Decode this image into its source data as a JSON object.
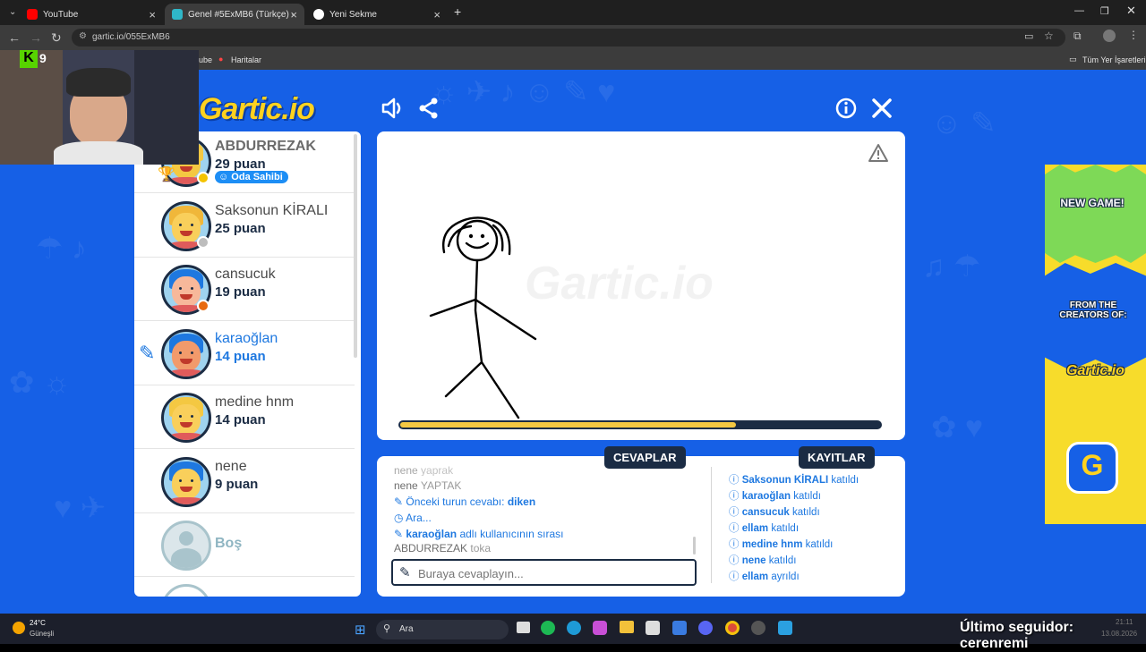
{
  "browser": {
    "tabs": [
      {
        "label": "YouTube",
        "active": false
      },
      {
        "label": "Genel #5ExMB6 (Türkçe) - Gartic",
        "active": true
      },
      {
        "label": "Yeni Sekme",
        "active": false
      }
    ],
    "new_tab": "+",
    "url": "gartic.io/055ExMB6",
    "bookmarks": [
      "ube",
      "Haritalar"
    ],
    "all_bookmarks": "Tüm Yer İşaretleri"
  },
  "webcam": {
    "badge_k": "K",
    "badge_num": "9"
  },
  "game": {
    "logo": "Gartic.io",
    "players": [
      {
        "name": "ABDURREZAK",
        "points": "29 puan",
        "badge": "Oda Sahibi",
        "bold_name": true,
        "dot": "#f4c300",
        "skin": "#f4c842",
        "hair": "#f4c842"
      },
      {
        "name": "Saksonun KİRALI",
        "points": "25 puan",
        "dot": "#bdbdbd",
        "skin": "#f9cf5b",
        "hair": "#f0b73a"
      },
      {
        "name": "cansucuk",
        "points": "19 puan",
        "dot": "#e8690e",
        "skin": "#f7b89a",
        "hair": "#1e78e0"
      },
      {
        "name": "karaoğlan",
        "points": "14 puan",
        "drawing": true,
        "skin": "#f29a6b",
        "hair": "#1e78e0"
      },
      {
        "name": "medine hnm",
        "points": "14 puan",
        "skin": "#f9cf5b",
        "hair": "#f4c842"
      },
      {
        "name": "nene",
        "points": "9 puan",
        "skin": "#f9cf5b",
        "hair": "#1e78e0"
      },
      {
        "name": "Boş",
        "points": ""
      }
    ],
    "progress_fraction": 0.7,
    "answers_title": "CEVAPLAR",
    "log_title": "KAYITLAR",
    "chat": [
      {
        "user": "nene",
        "text": "yaprak"
      },
      {
        "user": "nene",
        "text": "YAPTAK"
      },
      {
        "label": "Önceki turun cevabı:",
        "value": "diken",
        "icon": "pencil"
      },
      {
        "label": "Ara...",
        "icon": "clock"
      },
      {
        "user": "karaoğlan",
        "text": "adlı kullanıcının sırası",
        "icon": "pencil"
      },
      {
        "user": "ABDURREZAK",
        "text": "toka"
      }
    ],
    "answer_placeholder": "Buraya cevaplayın...",
    "log": [
      {
        "user": "Saksonun KİRALI",
        "action": "katıldı"
      },
      {
        "user": "karaoğlan",
        "action": "katıldı"
      },
      {
        "user": "cansucuk",
        "action": "katıldı"
      },
      {
        "user": "ellam",
        "action": "katıldı"
      },
      {
        "user": "medine hnm",
        "action": "katıldı"
      },
      {
        "user": "nene",
        "action": "katıldı"
      },
      {
        "user": "ellam",
        "action": "ayrıldı"
      }
    ],
    "watermark": "Gartic.io"
  },
  "ad": {
    "line1": "NEW GAME!",
    "line2": "FROM THE CREATORS OF:",
    "logo": "Gartic.io",
    "letter": "G"
  },
  "taskbar": {
    "temp": "24°C",
    "weather": "Güneşli",
    "search": "Ara",
    "follower": "Último seguidor: cerenremi",
    "date": "13.08.2026",
    "time": "21:11"
  },
  "colors": {
    "page_bg": "#1660e6",
    "navy": "#1b2c44",
    "accent_blue": "#1e78e0",
    "gold": "#f4c842"
  }
}
